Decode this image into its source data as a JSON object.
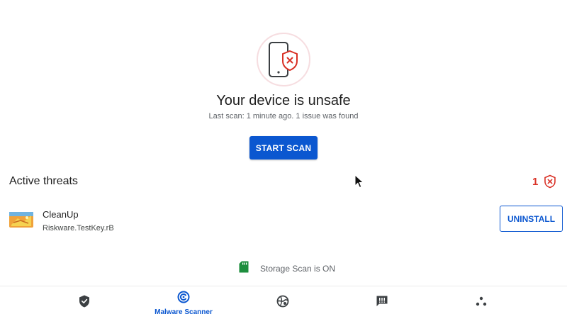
{
  "status": {
    "title": "Your device is unsafe",
    "subtitle": "Last scan: 1 minute ago. 1 issue was found",
    "scan_button": "START SCAN",
    "icon": "phone-shield-alert-icon"
  },
  "threats": {
    "section_title": "Active threats",
    "count": "1",
    "items": [
      {
        "app_name": "CleanUp",
        "threat_name": "Riskware.TestKey.rB",
        "action_label": "UNINSTALL",
        "icon": "cleanup-app-icon"
      }
    ]
  },
  "storage_scan": {
    "text": "Storage Scan is ON",
    "icon": "sd-card-icon"
  },
  "bottom_nav": {
    "items": [
      {
        "icon": "shield-check-icon",
        "label": ""
      },
      {
        "icon": "malware-scanner-icon",
        "label": "Malware Scanner",
        "active": true
      },
      {
        "icon": "web-protection-icon",
        "label": ""
      },
      {
        "icon": "message-alert-icon",
        "label": ""
      },
      {
        "icon": "more-icon",
        "label": ""
      }
    ]
  },
  "colors": {
    "primary": "#0b57d0",
    "danger": "#d93025",
    "storage_green": "#1e8e3e",
    "icon_gray": "#5f6368"
  }
}
